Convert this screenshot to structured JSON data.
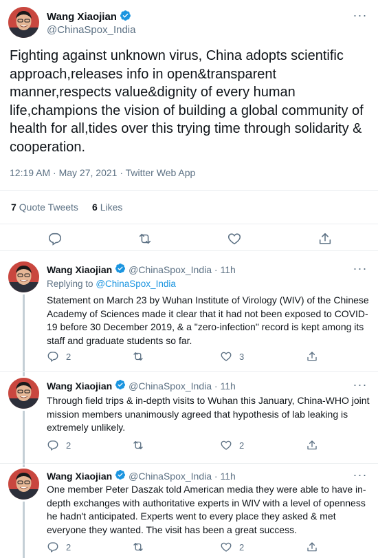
{
  "main_tweet": {
    "author_name": "Wang Xiaojian",
    "handle": "@ChinaSpox_India",
    "text": "Fighting against unknown virus, China adopts scientific approach,releases info in open&transparent manner,respects value&dignity of every human life,champions the vision of building a global community of health for all,tides over this trying time through solidarity & cooperation.",
    "timestamp": "12:19 AM · May 27, 2021 · Twitter Web App",
    "quote_tweets_count": "7",
    "quote_tweets_label": "Quote Tweets",
    "likes_count": "6",
    "likes_label": "Likes"
  },
  "replies": [
    {
      "author_name": "Wang Xiaojian",
      "handle_time": "@ChinaSpox_India · 11h",
      "replying_prefix": "Replying to",
      "replying_handle": "@ChinaSpox_India",
      "text": "Statement on March 23 by Wuhan Institute of Virology (WIV) of the Chinese Academy of Sciences made it clear that it had not been exposed to COVID-19 before 30 December 2019, & a \"zero-infection\" record is kept among its staff and graduate students so far.",
      "reply_count": "2",
      "retweet_count": "",
      "like_count": "3"
    },
    {
      "author_name": "Wang Xiaojian",
      "handle_time": "@ChinaSpox_India · 11h",
      "text": "Through field trips & in-depth visits to Wuhan this January, China-WHO joint mission members unanimously agreed that hypothesis of lab leaking is extremely unlikely.",
      "reply_count": "2",
      "retweet_count": "",
      "like_count": "2"
    },
    {
      "author_name": "Wang Xiaojian",
      "handle_time": "@ChinaSpox_India · 11h",
      "text": "One member Peter Daszak told American media they were able to have in-depth exchanges with authoritative experts in WIV with a level of openness he hadn't anticipated. Experts went to every place they asked & met everyone they wanted. The visit has been a great success.",
      "reply_count": "2",
      "retweet_count": "",
      "like_count": "2"
    }
  ],
  "icons": {
    "verified": "verified-badge-icon",
    "more": "more-icon",
    "reply": "reply-icon",
    "retweet": "retweet-icon",
    "like": "like-icon",
    "share": "share-icon"
  },
  "colors": {
    "accent": "#1b95e0",
    "secondary_text": "#5b7083",
    "border": "#ebeef0",
    "thread_line": "#c4cfd6"
  }
}
